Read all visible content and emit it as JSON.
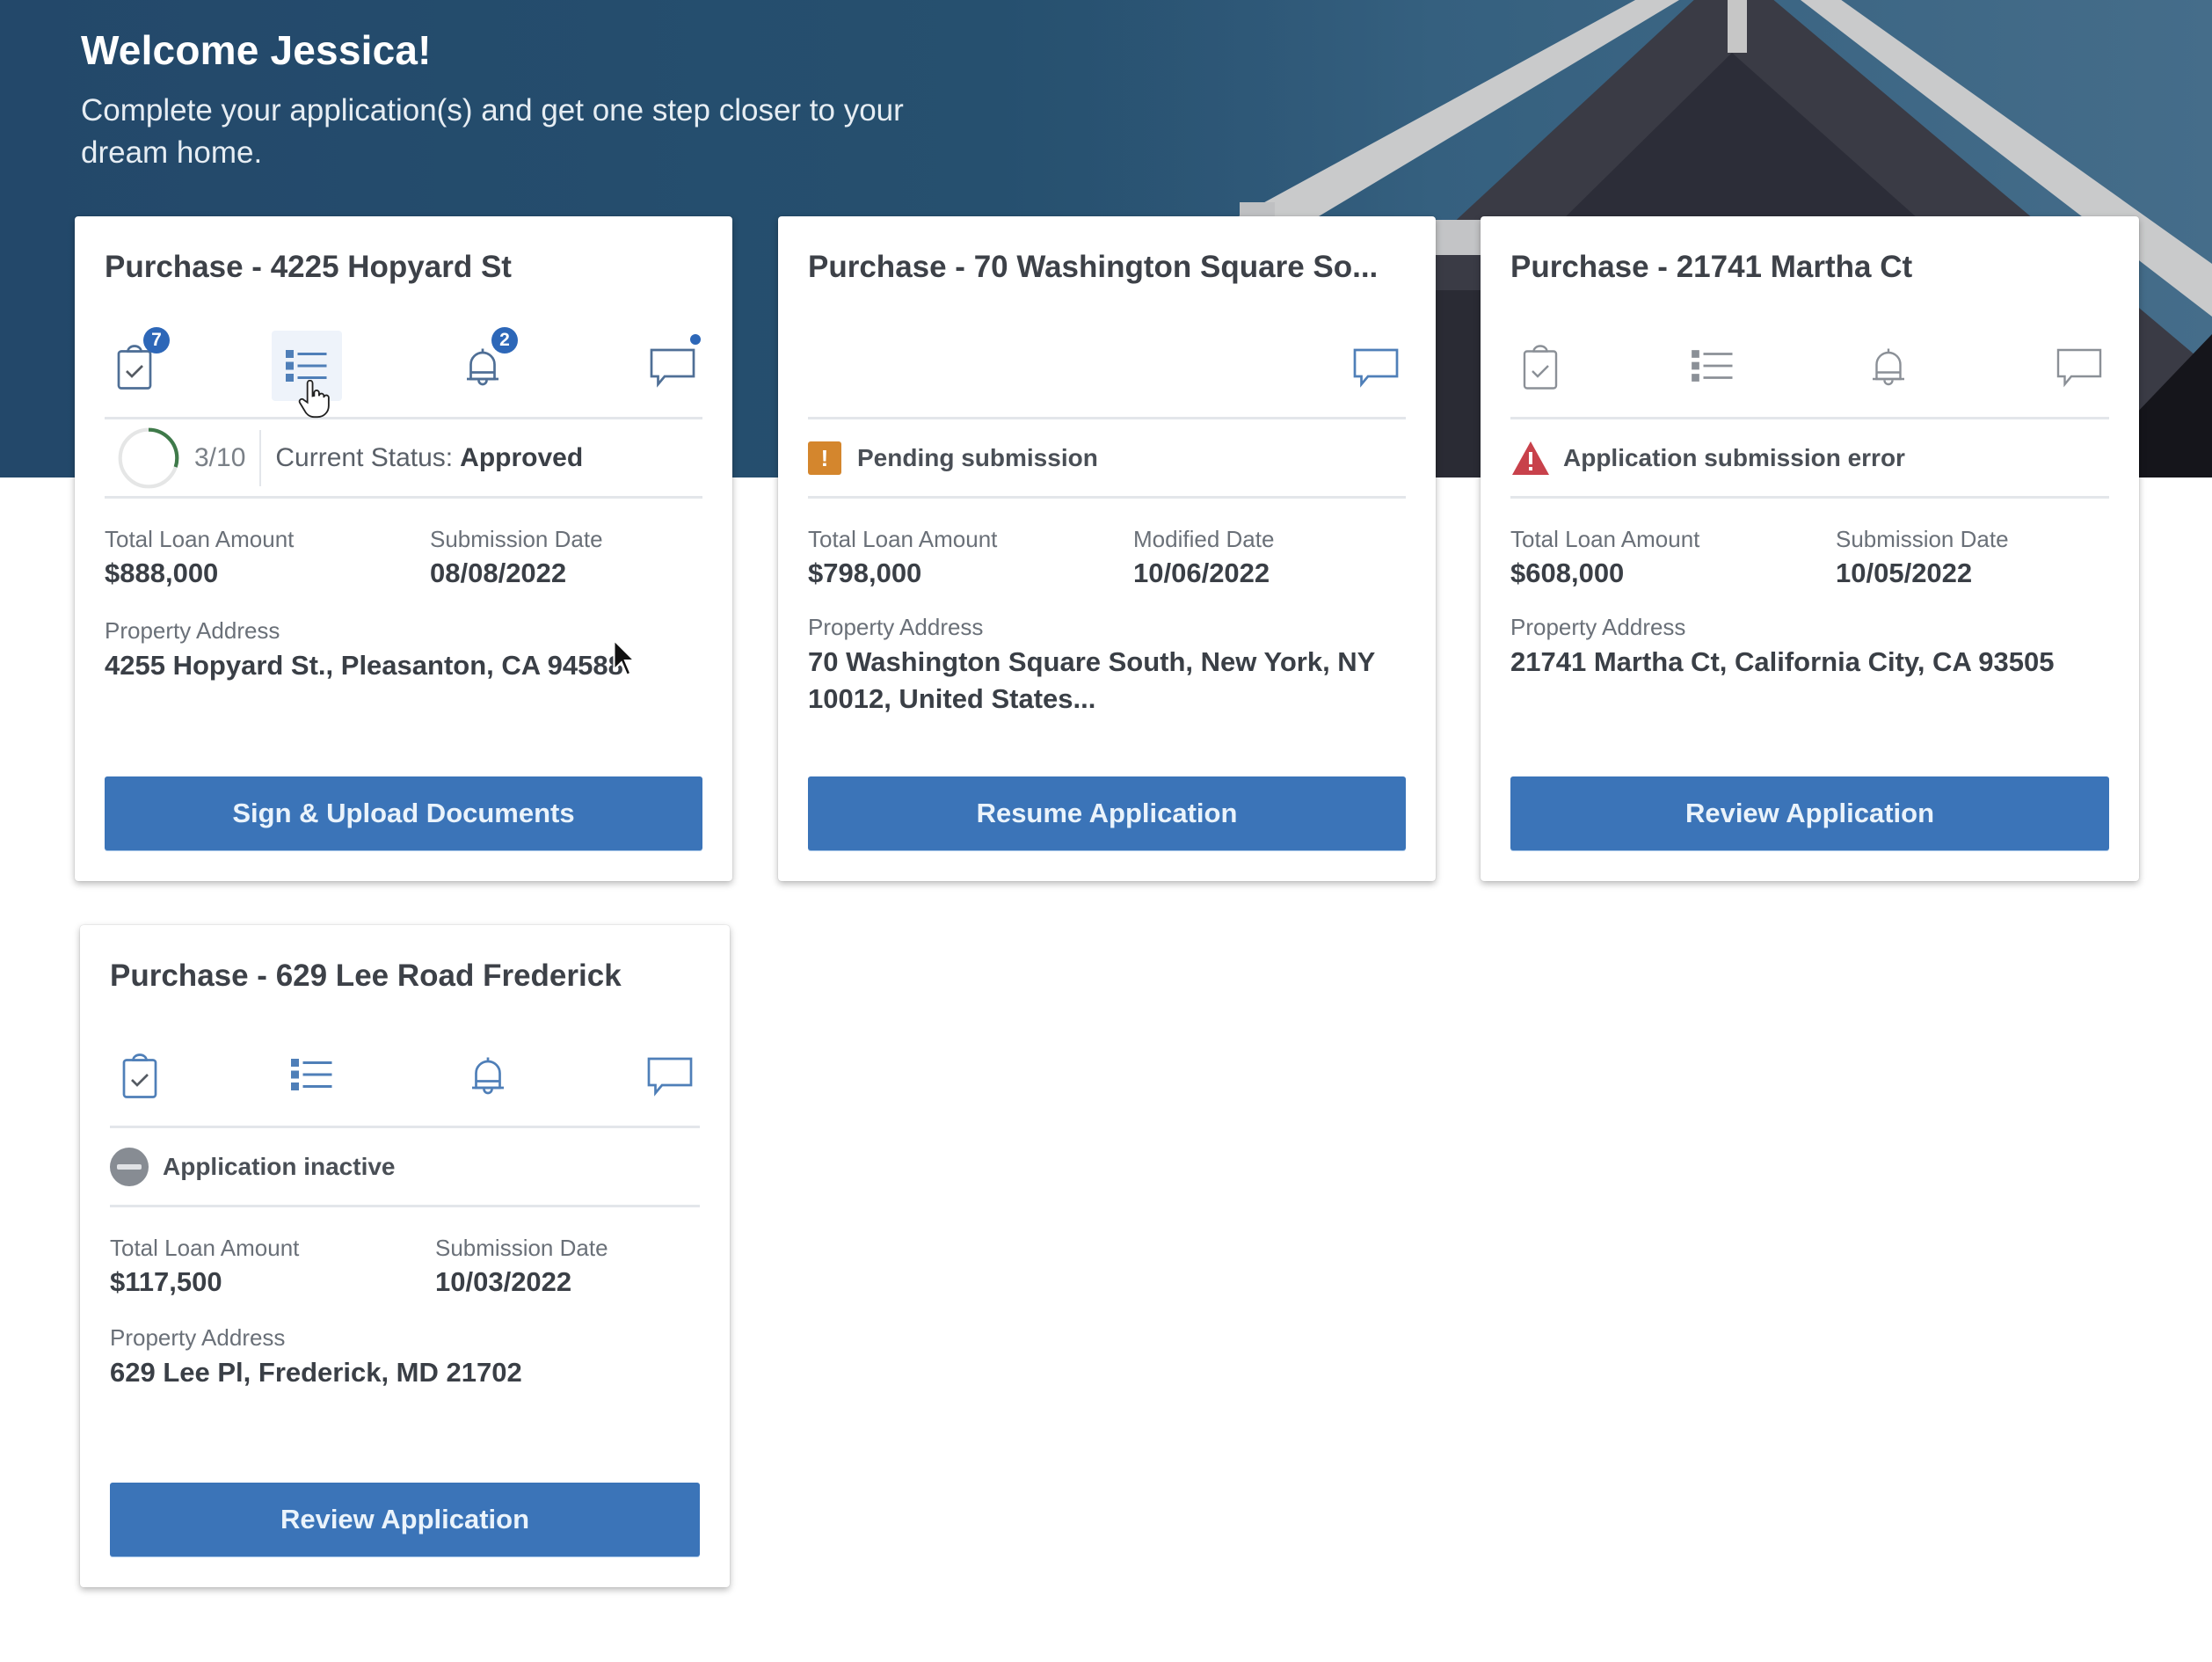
{
  "hero": {
    "title": "Welcome Jessica!",
    "subtitle": "Complete your application(s) and get one step closer to your dream home."
  },
  "colors": {
    "hero_bg": "#23486a",
    "primary_button": "#3b74b8",
    "badge": "#2d67b8",
    "pending": "#d4862d",
    "error": "#c8414b",
    "inactive": "#878c93",
    "progress": "#3f7a4a"
  },
  "cards": [
    {
      "title": "Purchase - 4225 Hopyard St",
      "icons": {
        "tasks": {
          "name": "clipboard-check-icon",
          "badge": "7"
        },
        "checklist": {
          "name": "list-icon"
        },
        "alerts": {
          "name": "bell-icon",
          "badge": "2"
        },
        "messages": {
          "name": "chat-icon",
          "unread": true
        }
      },
      "progress": {
        "completed": 3,
        "total": 10,
        "label": "3/10"
      },
      "status_label": "Current Status:",
      "status_value": "Approved",
      "loan_label": "Total Loan Amount",
      "loan_value": "$888,000",
      "date_label": "Submission Date",
      "date_value": "08/08/2022",
      "address_label": "Property Address",
      "address_value": "4255 Hopyard St., Pleasanton, CA 94588",
      "button": "Sign & Upload Documents"
    },
    {
      "title": "Purchase - 70 Washington Square So...",
      "icons": {
        "messages": {
          "name": "chat-icon"
        }
      },
      "status_icon": "warning-square-icon",
      "status_text": "Pending submission",
      "loan_label": "Total Loan Amount",
      "loan_value": "$798,000",
      "date_label": "Modified Date",
      "date_value": "10/06/2022",
      "address_label": "Property Address",
      "address_value": "70 Washington Square South, New York, NY 10012, United States...",
      "button": "Resume Application"
    },
    {
      "title": "Purchase - 21741 Martha Ct",
      "icons": {
        "tasks": {
          "name": "clipboard-check-icon"
        },
        "checklist": {
          "name": "list-icon"
        },
        "alerts": {
          "name": "bell-icon"
        },
        "messages": {
          "name": "chat-icon"
        }
      },
      "status_icon": "error-triangle-icon",
      "status_text": "Application submission error",
      "loan_label": "Total Loan Amount",
      "loan_value": "$608,000",
      "date_label": "Submission Date",
      "date_value": "10/05/2022",
      "address_label": "Property Address",
      "address_value": "21741 Martha Ct, California City, CA 93505",
      "button": "Review Application"
    },
    {
      "title": "Purchase - 629 Lee Road Frederick",
      "icons": {
        "tasks": {
          "name": "clipboard-check-icon"
        },
        "checklist": {
          "name": "list-icon"
        },
        "alerts": {
          "name": "bell-icon"
        },
        "messages": {
          "name": "chat-icon"
        }
      },
      "status_icon": "inactive-icon",
      "status_text": "Application inactive",
      "loan_label": "Total Loan Amount",
      "loan_value": "$117,500",
      "date_label": "Submission Date",
      "date_value": "10/03/2022",
      "address_label": "Property Address",
      "address_value": "629 Lee Pl, Frederick, MD 21702",
      "button": "Review Application"
    }
  ]
}
